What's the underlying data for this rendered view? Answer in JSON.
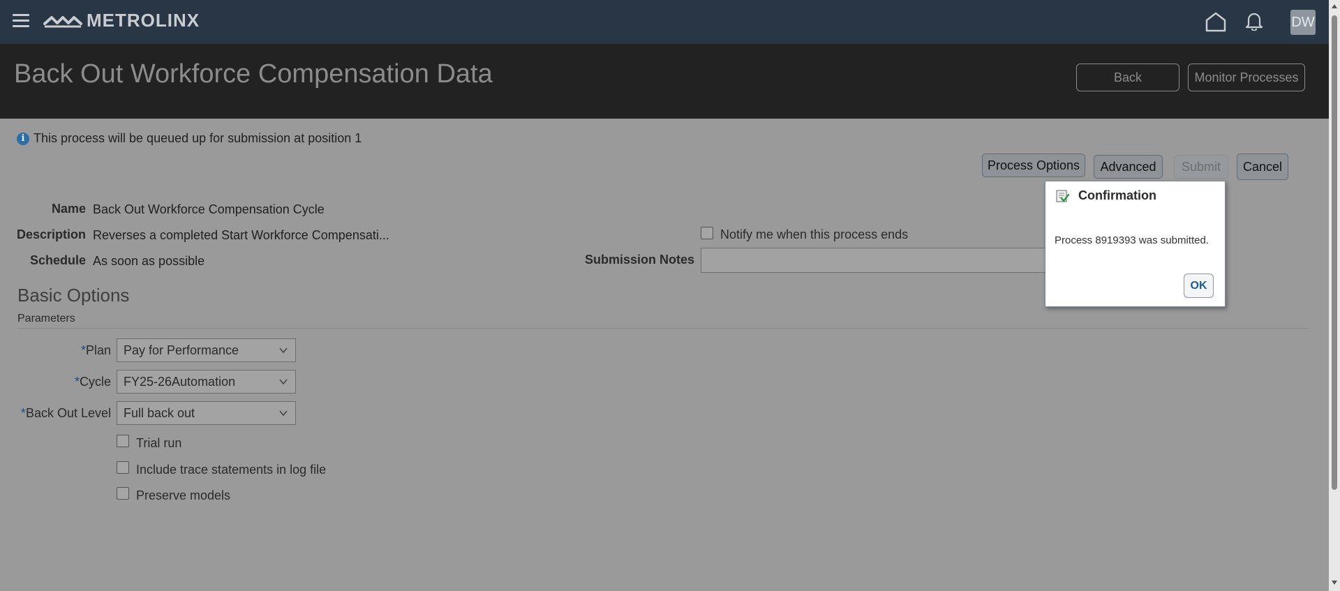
{
  "topbar": {
    "logo_text": "METROLINX",
    "avatar_initials": "DW"
  },
  "header": {
    "title": "Back Out Workforce Compensation Data",
    "back_label": "Back",
    "monitor_label": "Monitor Processes"
  },
  "info": {
    "message": "This process will be queued up for submission at position 1"
  },
  "actions": {
    "process_options": "Process Options",
    "advanced": "Advanced",
    "submit": "Submit",
    "cancel": "Cancel"
  },
  "details": {
    "name_label": "Name",
    "name_value": "Back Out Workforce Compensation Cycle",
    "description_label": "Description",
    "description_value": "Reverses a completed Start Workforce Compensati...",
    "schedule_label": "Schedule",
    "schedule_value": "As soon as possible",
    "notify_label": "Notify me when this process ends",
    "notes_label": "Submission Notes",
    "notes_value": ""
  },
  "basic_options": {
    "title": "Basic Options",
    "parameters_label": "Parameters",
    "required_mark": "*",
    "plan_label": "Plan",
    "plan_value": "Pay for Performance",
    "cycle_label": "Cycle",
    "cycle_value": "FY25-26Automation",
    "backout_label": "Back Out Level",
    "backout_value": "Full back out",
    "trial_run_label": "Trial run",
    "trace_label": "Include trace statements in log file",
    "preserve_label": "Preserve models"
  },
  "dialog": {
    "title": "Confirmation",
    "message": "Process 8919393 was submitted.",
    "ok_label": "OK"
  },
  "icons": {
    "menu": "hamburger-menu-icon",
    "logo": "metrolinx-logo-icon",
    "home": "home-icon",
    "notifications": "bell-icon",
    "info": "info-icon",
    "dropdown": "chevron-down-icon",
    "confirm": "confirmation-icon"
  },
  "colors": {
    "topbar": "#283645",
    "header": "#222222",
    "overlay_bg": "#9a9a9a",
    "link_blue": "#1a5a98"
  }
}
